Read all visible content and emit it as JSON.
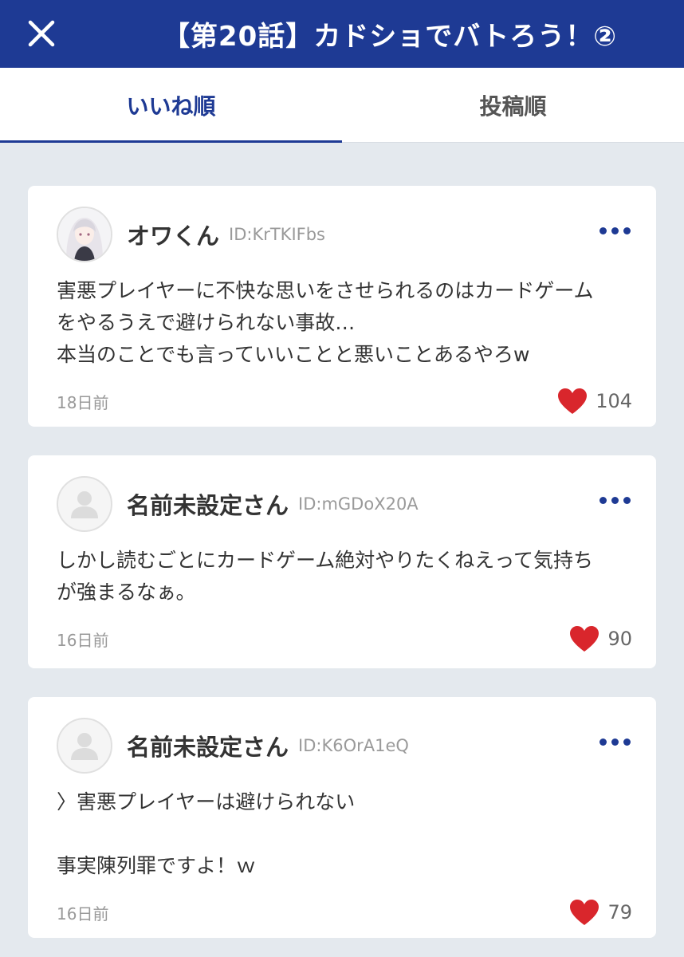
{
  "header": {
    "title": "【第20話】カドショでバトろう！②"
  },
  "tabs": [
    {
      "label": "いいね順",
      "active": true
    },
    {
      "label": "投稿順",
      "active": false
    }
  ],
  "colors": {
    "brand": "#1e3a94",
    "like": "#d9262c",
    "background": "#e4e9ee"
  },
  "comments": [
    {
      "username": "オワくん",
      "user_id": "ID:KrTKIFbs",
      "avatar": "anime-avatar",
      "body": "害悪プレイヤーに不快な思いをさせられるのはカードゲーム\nをやるうえで避けられない事故…\n本当のことでも言っていいことと悪いことあるやろw",
      "time": "18日前",
      "likes": "104"
    },
    {
      "username": "名前未設定さん",
      "user_id": "ID:mGDoX20A",
      "avatar": "default-user-icon",
      "body": "しかし読むごとにカードゲーム絶対やりたくねえって気持ち\nが強まるなぁ。",
      "time": "16日前",
      "likes": "90"
    },
    {
      "username": "名前未設定さん",
      "user_id": "ID:K6OrA1eQ",
      "avatar": "default-user-icon",
      "body": "〉害悪プレイヤーは避けられない\n\n事実陳列罪ですよ！ｗ",
      "time": "16日前",
      "likes": "79"
    }
  ]
}
